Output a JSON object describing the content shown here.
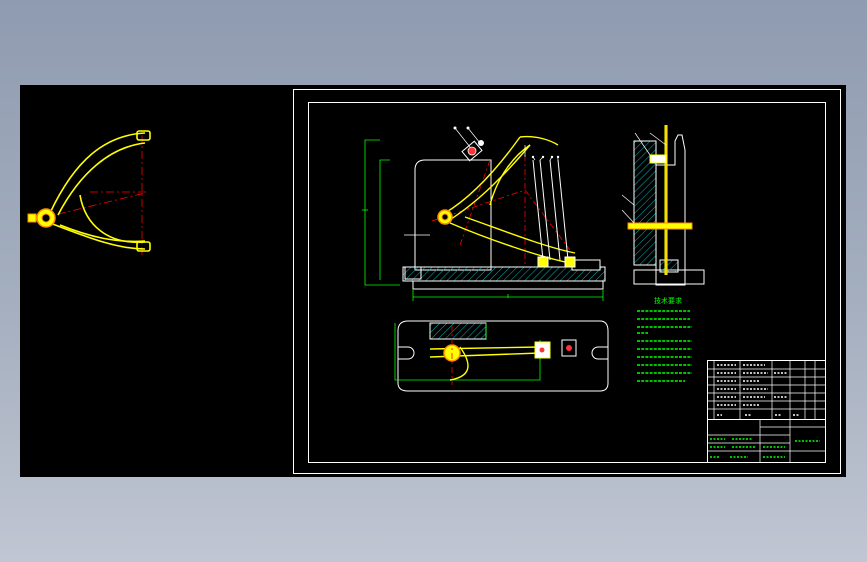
{
  "colors": {
    "background": "#000000",
    "outline": "#ffffff",
    "part": "#ffff00",
    "part_stroke": "#ff8c00",
    "centerline": "#ff0000",
    "dimension": "#00ff00",
    "hatch": "#00b4b4",
    "leader": "#ffffff",
    "notes": "#00ff00"
  },
  "drawing": {
    "notes_title": "技术要求"
  }
}
